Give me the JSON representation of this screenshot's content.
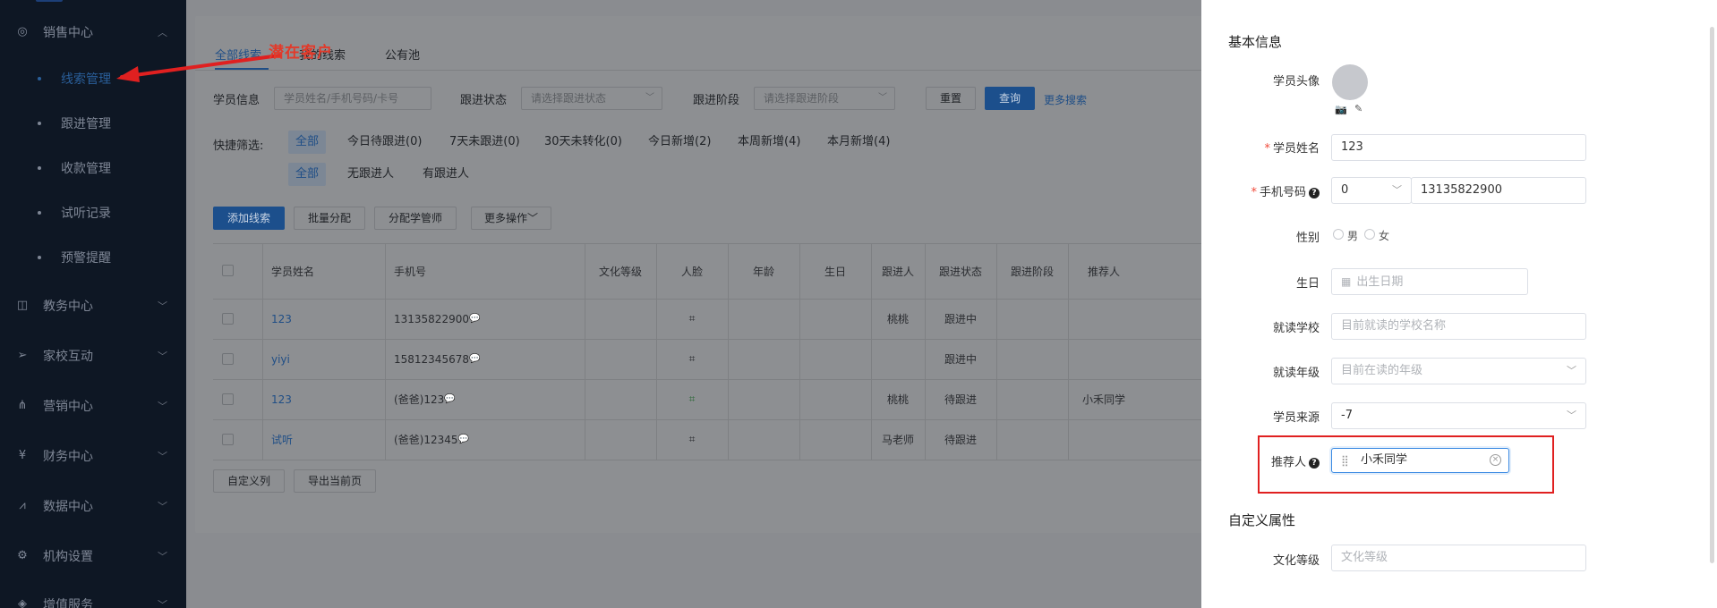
{
  "sidebar": {
    "groups": [
      {
        "label": "销售中心",
        "icon": "sales-icon"
      },
      {
        "label": "教务中心",
        "icon": "book-icon"
      },
      {
        "label": "家校互动",
        "icon": "send-icon"
      },
      {
        "label": "营销中心",
        "icon": "share-icon"
      },
      {
        "label": "财务中心",
        "icon": "finance-icon"
      },
      {
        "label": "数据中心",
        "icon": "chart-icon"
      },
      {
        "label": "机构设置",
        "icon": "gear-icon"
      },
      {
        "label": "增值服务",
        "icon": "service-icon"
      }
    ],
    "sales_items": [
      "线索管理",
      "跟进管理",
      "收款管理",
      "试听记录",
      "预警提醒"
    ]
  },
  "annotation": {
    "text": "潜在客户"
  },
  "main": {
    "tabs": [
      "全部线索",
      "我的线索",
      "公有池"
    ],
    "filters": {
      "student_label": "学员信息",
      "student_placeholder": "学员姓名/手机号码/卡号",
      "status_label": "跟进状态",
      "status_placeholder": "请选择跟进状态",
      "stage_label": "跟进阶段",
      "stage_placeholder": "请选择跟进阶段",
      "reset": "重置",
      "query": "查询",
      "more_search": "更多搜索"
    },
    "quick_filter": {
      "label": "快捷筛选:",
      "row1": [
        "全部",
        "今日待跟进(0)",
        "7天未跟进(0)",
        "30天未转化(0)",
        "今日新增(2)",
        "本周新增(4)",
        "本月新增(4)"
      ],
      "row2": [
        "全部",
        "无跟进人",
        "有跟进人"
      ]
    },
    "actions": {
      "add": "添加线索",
      "batch": "批量分配",
      "assign": "分配学管师",
      "more": "更多操作"
    },
    "table": {
      "headers": [
        "学员姓名",
        "手机号",
        "文化等级",
        "人脸",
        "年龄",
        "生日",
        "跟进人",
        "跟进状态",
        "跟进阶段",
        "推荐人"
      ],
      "rows": [
        {
          "name": "123",
          "phone": "13135822900",
          "follower": "桃桃",
          "status": "跟进中",
          "referrer": ""
        },
        {
          "name": "yiyi",
          "phone": "15812345678",
          "follower": "",
          "status": "跟进中",
          "referrer": ""
        },
        {
          "name": "123",
          "phone": "(爸爸)123",
          "follower": "桃桃",
          "status": "待跟进",
          "referrer": "小禾同学"
        },
        {
          "name": "试听",
          "phone": "(爸爸)12345",
          "follower": "马老师",
          "status": "待跟进",
          "referrer": ""
        }
      ]
    },
    "footer": {
      "custom_cols": "自定义列",
      "export": "导出当前页"
    }
  },
  "drawer": {
    "basic_title": "基本信息",
    "avatar_label": "学员头像",
    "name_label": "学员姓名",
    "name_value": "123",
    "phone_label": "手机号码",
    "phone_prefix": "0",
    "phone_value": "13135822900",
    "gender_label": "性别",
    "gender_male": "男",
    "gender_female": "女",
    "birthday_label": "生日",
    "birthday_placeholder": "出生日期",
    "school_label": "就读学校",
    "school_placeholder": "目前就读的学校名称",
    "grade_label": "就读年级",
    "grade_placeholder": "目前在读的年级",
    "source_label": "学员来源",
    "source_value": "-7",
    "referrer_label": "推荐人",
    "referrer_value": "小禾同学",
    "custom_title": "自定义属性",
    "culture_label": "文化等级",
    "culture_placeholder": "文化等级"
  },
  "colors": {
    "accent": "#3c8be3",
    "annotation": "#e02020",
    "sidebar_bg": "#0e1724"
  }
}
